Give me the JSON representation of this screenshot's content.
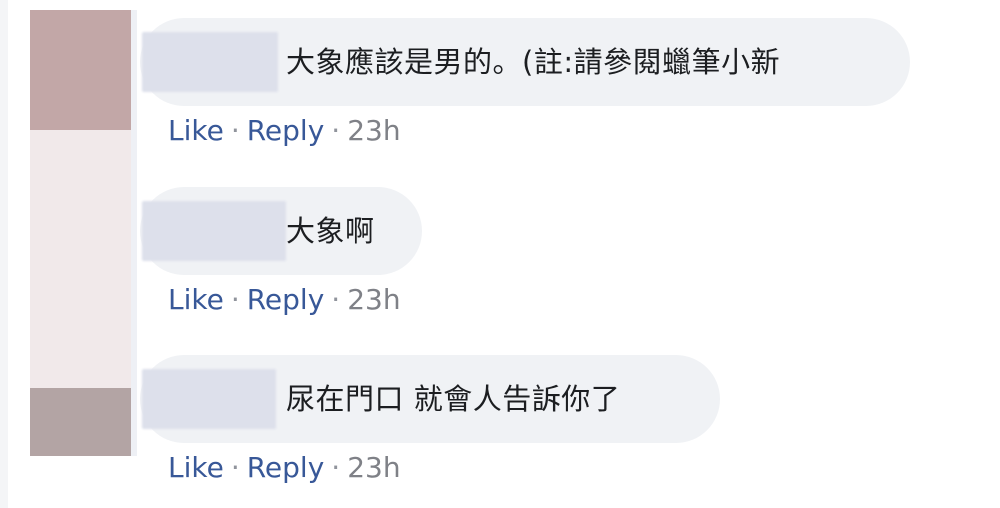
{
  "comments": [
    {
      "text": "大象應該是男的。(註:請參閱蠟筆小新",
      "actions": {
        "like": "Like",
        "reply": "Reply",
        "separator": "·",
        "time": "23h"
      }
    },
    {
      "text": "大象啊",
      "actions": {
        "like": "Like",
        "reply": "Reply",
        "separator": "·",
        "time": "23h"
      }
    },
    {
      "text": "尿在門口 就會人告訴你了",
      "actions": {
        "like": "Like",
        "reply": "Reply",
        "separator": "·",
        "time": "23h"
      }
    }
  ],
  "colors": {
    "bubble_bg": "#f0f2f5",
    "link": "#385898",
    "meta": "#8a8d91",
    "text": "#1c1e21"
  }
}
